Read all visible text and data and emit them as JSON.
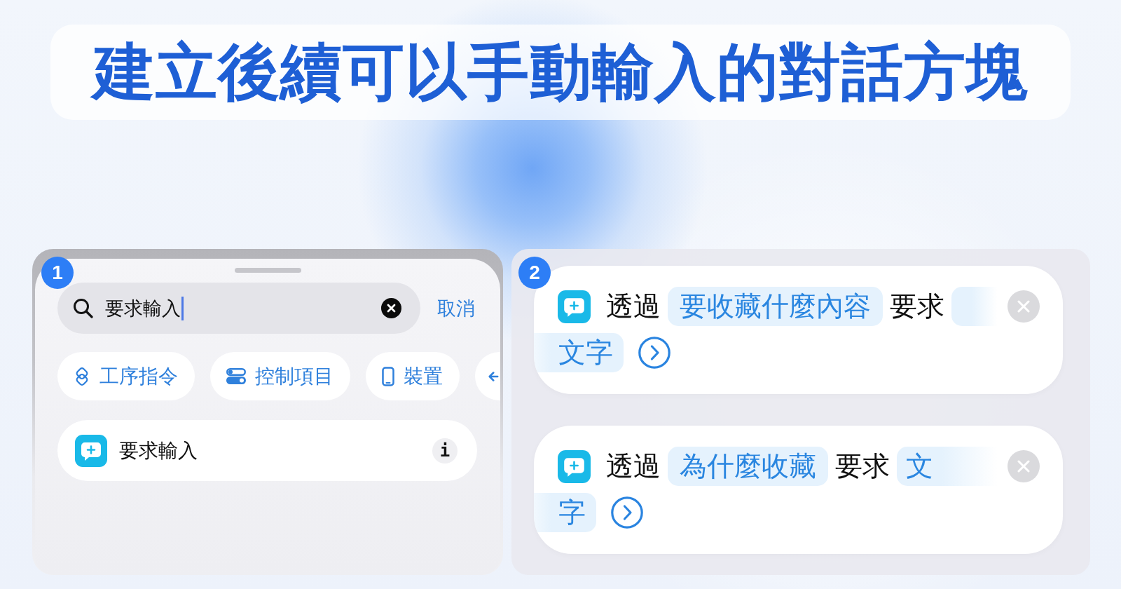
{
  "title": "建立後續可以手動輸入的對話方塊",
  "search_step": {
    "step": "1",
    "search": {
      "value": "要求輸入",
      "cancel": "取消"
    },
    "categories": [
      {
        "kind": "shortcuts",
        "label": "工序指令"
      },
      {
        "kind": "controls",
        "label": "控制項目"
      },
      {
        "kind": "device",
        "label": "裝置"
      },
      {
        "kind": "cut"
      }
    ],
    "results": [
      {
        "label": "要求輸入",
        "info": "i"
      }
    ]
  },
  "action_step": {
    "step": "2",
    "actions": [
      {
        "lines": [
          {
            "segments": [
              {
                "kind": "word",
                "text": "透過"
              },
              {
                "kind": "variable",
                "text": "要收藏什麼內容"
              },
              {
                "kind": "word",
                "text": "要求"
              },
              {
                "kind": "variable_wrap"
              }
            ]
          },
          {
            "segments": [
              {
                "kind": "variable_rest",
                "text": "文字"
              }
            ]
          }
        ]
      },
      {
        "lines": [
          {
            "segments": [
              {
                "kind": "word",
                "text": "透過"
              },
              {
                "kind": "variable",
                "text": "為什麼收藏"
              },
              {
                "kind": "word",
                "text": "要求"
              },
              {
                "kind": "variable_wrap",
                "text": "文"
              }
            ]
          },
          {
            "segments": [
              {
                "kind": "variable_rest",
                "text": "字"
              }
            ]
          }
        ]
      }
    ]
  }
}
